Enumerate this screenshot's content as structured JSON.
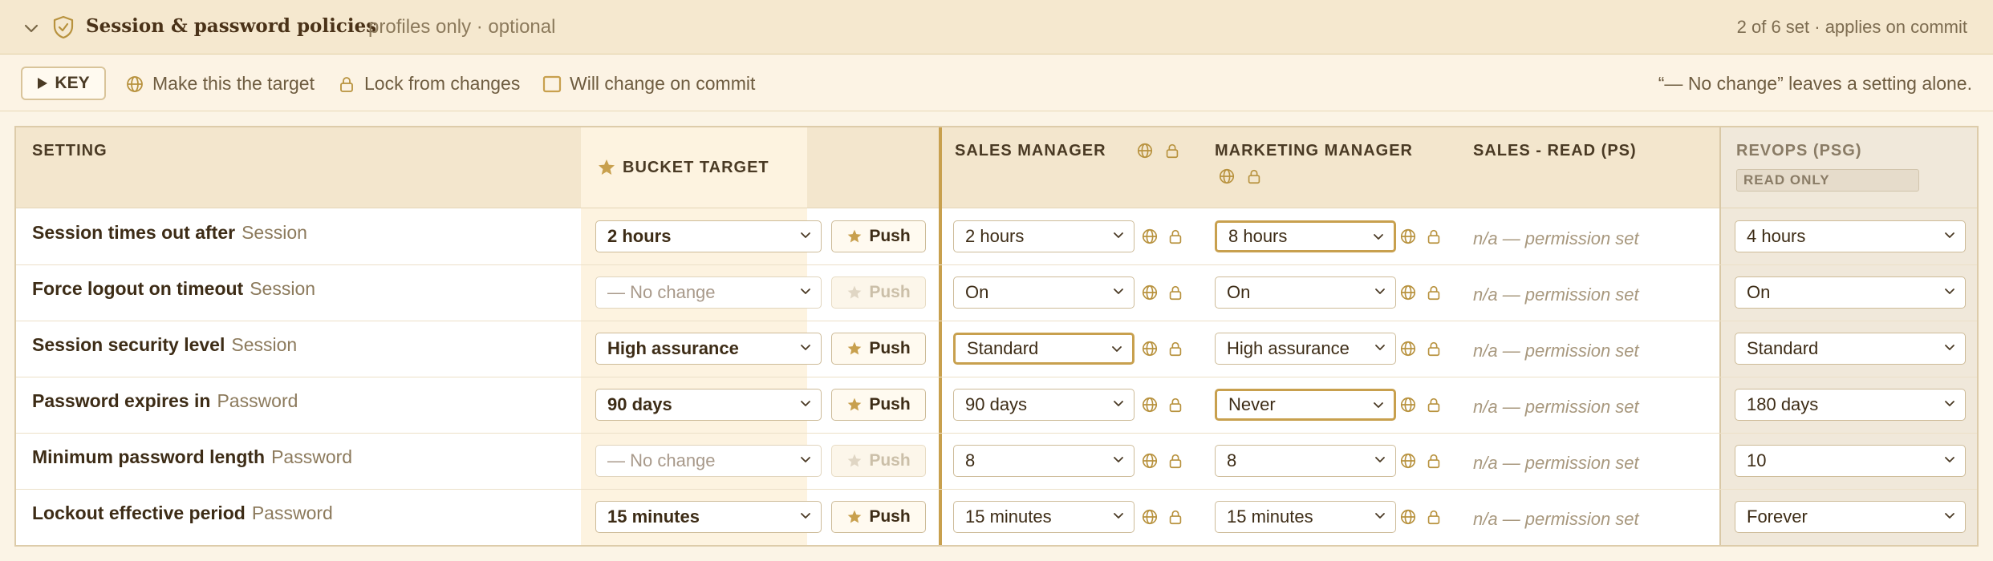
{
  "section": {
    "title": "Session & password policies",
    "subtitle": "profiles only · optional",
    "status": "2 of 6 set · applies on commit"
  },
  "key": {
    "button_label": "KEY",
    "items": [
      "Make this the target",
      "Lock from changes",
      "Will change on commit"
    ],
    "note": "“— No change” leaves a setting alone."
  },
  "columns": {
    "setting": "SETTING",
    "bucket": "BUCKET TARGET",
    "sales_manager": "SALES MANAGER",
    "marketing_manager": "MARKETING MANAGER",
    "sales_read": "SALES - READ (PS)",
    "revops": "REVOPS (PSG)",
    "read_only": "READ ONLY"
  },
  "push_label": "Push",
  "na_text": "n/a — permission set",
  "rows": [
    {
      "name": "Session times out after",
      "group": "Session",
      "bucket": "2 hours",
      "sales_manager": "2 hours",
      "marketing_manager": "8 hours",
      "revops": "4 hours"
    },
    {
      "name": "Force logout on timeout",
      "group": "Session",
      "bucket": "— No change",
      "sales_manager": "On",
      "marketing_manager": "On",
      "revops": "On"
    },
    {
      "name": "Session security level",
      "group": "Session",
      "bucket": "High assurance",
      "sales_manager": "Standard",
      "marketing_manager": "High assurance",
      "revops": "Standard"
    },
    {
      "name": "Password expires in",
      "group": "Password",
      "bucket": "90 days",
      "sales_manager": "90 days",
      "marketing_manager": "Never",
      "revops": "180 days"
    },
    {
      "name": "Minimum password length",
      "group": "Password",
      "bucket": "— No change",
      "sales_manager": "8",
      "marketing_manager": "8",
      "revops": "10"
    },
    {
      "name": "Lockout effective period",
      "group": "Password",
      "bucket": "15 minutes",
      "sales_manager": "15 minutes",
      "marketing_manager": "15 minutes",
      "revops": "Forever"
    }
  ],
  "colors": {
    "accent": "#c8a04e",
    "header_bg": "#f5e8cf",
    "bucket_bg": "#fdf3e0",
    "revops_bg": "#f0e8da"
  }
}
